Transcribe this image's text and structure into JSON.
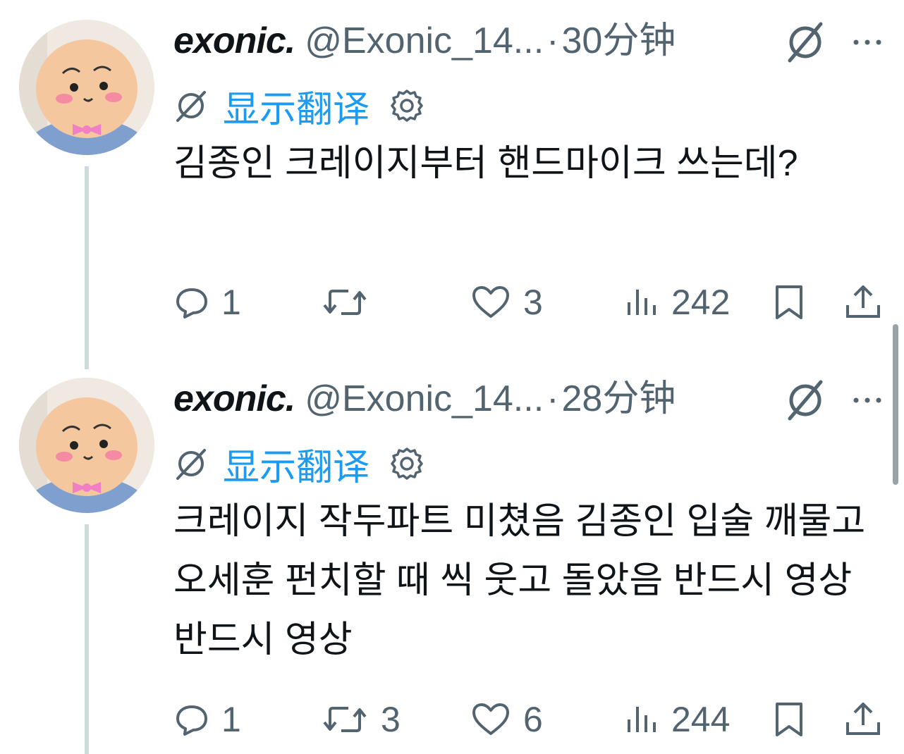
{
  "tweets": [
    {
      "display_name": "exonic.",
      "handle": "@Exonic_14...",
      "separator": "·",
      "time": "30分钟",
      "translate_label": "显示翻译",
      "text": "김종인 크레이지부터 핸드마이크 쓰는데?",
      "reply_count": "1",
      "retweet_count": "",
      "like_count": "3",
      "view_count": "242",
      "avatar_icon": "mascot-avatar",
      "accent_color": "#1d9bf0"
    },
    {
      "display_name": "exonic.",
      "handle": "@Exonic_14...",
      "separator": "·",
      "time": "28分钟",
      "translate_label": "显示翻译",
      "text": "크레이지 작두파트 미쳤음 김종인 입술 깨물고 오세훈 펀치할 때 씩 웃고 돌았음 반드시 영상 반드시 영상",
      "reply_count": "1",
      "retweet_count": "3",
      "like_count": "6",
      "view_count": "244",
      "avatar_icon": "mascot-avatar",
      "accent_color": "#1d9bf0"
    }
  ],
  "icons": {
    "grok": "grok-slash-icon",
    "more": "more-dots-icon",
    "translate": "translate-slash-icon",
    "settings": "gear-icon",
    "reply": "reply-bubble-icon",
    "retweet": "retweet-icon",
    "like": "heart-icon",
    "views": "views-bars-icon",
    "bookmark": "bookmark-icon",
    "share": "share-icon"
  }
}
